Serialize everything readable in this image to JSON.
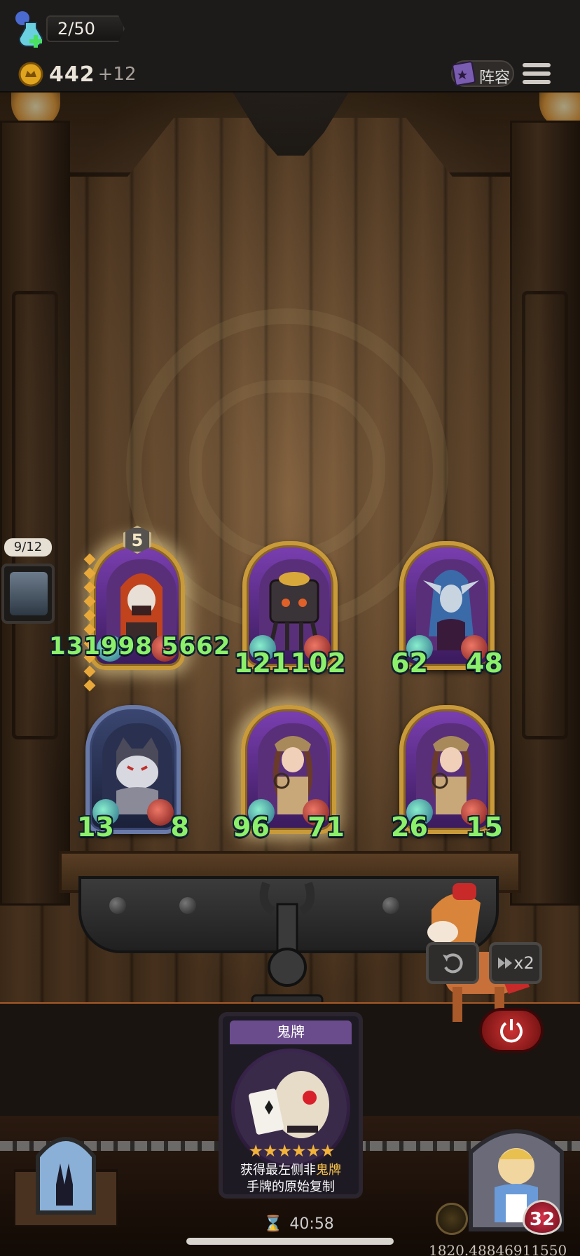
{
  "hud": {
    "potion_count": "2/50",
    "gold": "442",
    "gold_income": "+12",
    "lineup_label": "阵容"
  },
  "side_panel": {
    "badge": "9/12"
  },
  "board": {
    "units": [
      {
        "level": "5",
        "attack": "131998",
        "health": "5662",
        "frame": "gold",
        "selected": true
      },
      {
        "attack": "121",
        "health": "102",
        "frame": "gold"
      },
      {
        "attack": "62",
        "health": "48",
        "frame": "gold"
      },
      {
        "attack": "13",
        "health": "8",
        "frame": "blue"
      },
      {
        "attack": "96",
        "health": "71",
        "frame": "gold",
        "selected": true
      },
      {
        "attack": "26",
        "health": "15",
        "frame": "gold"
      }
    ],
    "first_unit_full_stats": "131998 5662"
  },
  "controls": {
    "speed_label": "x2"
  },
  "shop_card": {
    "title": "鬼牌",
    "stars": "★★★★★★",
    "desc_line1_prefix": "获得最左侧非",
    "desc_line1_highlight": "鬼牌",
    "desc_line2": "手牌的原始复制"
  },
  "player": {
    "health": "32"
  },
  "footer": {
    "timer": "40:58",
    "coords": "1820.4884691​1550"
  },
  "colors": {
    "stat_green": "#8cf06a",
    "gold_frame": "#c99a3a",
    "accent_purple": "#6a4c8c",
    "highlight_yellow": "#f6c24a",
    "power_red": "#c33333"
  },
  "icons": [
    "potion-icon",
    "coin-icon",
    "book-icon",
    "menu-icon",
    "undo-icon",
    "fast-forward-icon",
    "power-icon",
    "hourglass-icon",
    "bell-icon",
    "heart-icon"
  ]
}
